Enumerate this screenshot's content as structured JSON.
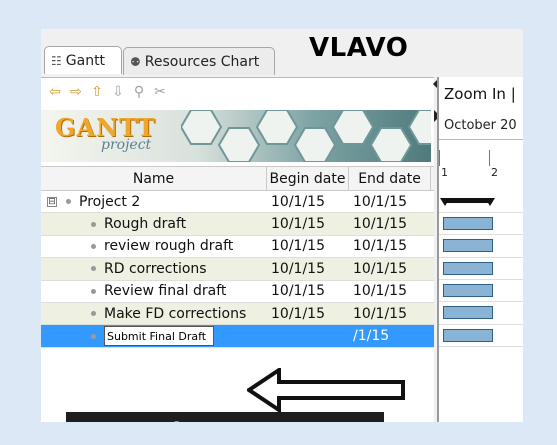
{
  "brand": "VLAVO",
  "tabs": [
    {
      "label": "Gantt",
      "icon": "gantt-icon"
    },
    {
      "label": "Resources Chart",
      "icon": "resources-icon"
    }
  ],
  "toolbar": [
    {
      "icon": "arrow-left-icon",
      "glyph": "⇦"
    },
    {
      "icon": "arrow-right-icon",
      "glyph": "⇨"
    },
    {
      "icon": "arrow-up-icon",
      "glyph": "⇧"
    },
    {
      "icon": "arrow-down-icon",
      "glyph": "⇩"
    },
    {
      "icon": "link-icon",
      "glyph": "⚲"
    },
    {
      "icon": "unlink-icon",
      "glyph": "✂"
    }
  ],
  "logo": {
    "line1": "GANTT",
    "line2": "project"
  },
  "table": {
    "headers": {
      "name": "Name",
      "begin": "Begin date",
      "end": "End date"
    },
    "project": {
      "name": "Project 2",
      "begin": "10/1/15",
      "end": "10/1/15",
      "expander": "⊟"
    },
    "tasks": [
      {
        "name": "Rough draft",
        "begin": "10/1/15",
        "end": "10/1/15"
      },
      {
        "name": "review rough draft",
        "begin": "10/1/15",
        "end": "10/1/15"
      },
      {
        "name": "RD corrections",
        "begin": "10/1/15",
        "end": "10/1/15"
      },
      {
        "name": "Review final draft",
        "begin": "10/1/15",
        "end": "10/1/15"
      },
      {
        "name": "Make FD corrections",
        "begin": "10/1/15",
        "end": "10/1/15"
      }
    ],
    "editing": {
      "value": "Submit Final Draft",
      "end": "/1/15"
    }
  },
  "site": "vlavo.com",
  "chart": {
    "zoom_label": "Zoom In |",
    "month": "October 20",
    "ticks": [
      "1",
      "2"
    ]
  },
  "colors": {
    "selection": "#3399ff",
    "bar": "#8bb4d4",
    "accent": "#f0a62d"
  }
}
